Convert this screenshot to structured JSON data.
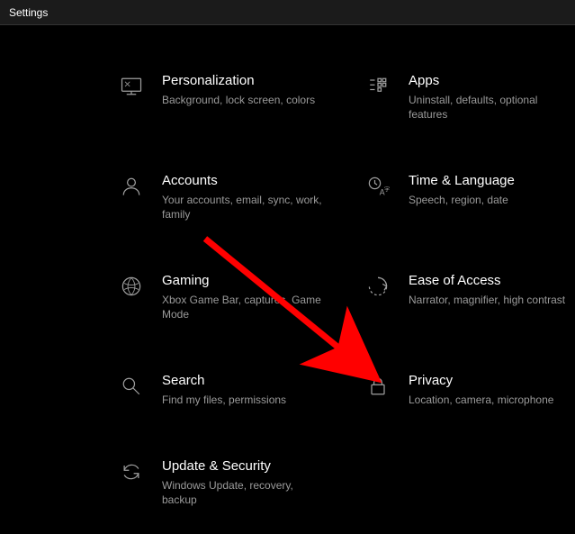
{
  "window": {
    "title": "Settings"
  },
  "tiles": {
    "personalization": {
      "title": "Personalization",
      "sub": "Background, lock screen, colors"
    },
    "apps": {
      "title": "Apps",
      "sub": "Uninstall, defaults, optional features"
    },
    "accounts": {
      "title": "Accounts",
      "sub": "Your accounts, email, sync, work, family"
    },
    "time": {
      "title": "Time & Language",
      "sub": "Speech, region, date"
    },
    "gaming": {
      "title": "Gaming",
      "sub": "Xbox Game Bar, captures, Game Mode"
    },
    "ease": {
      "title": "Ease of Access",
      "sub": "Narrator, magnifier, high contrast"
    },
    "search": {
      "title": "Search",
      "sub": "Find my files, permissions"
    },
    "privacy": {
      "title": "Privacy",
      "sub": "Location, camera, microphone"
    },
    "update": {
      "title": "Update & Security",
      "sub": "Windows Update, recovery, backup"
    }
  }
}
